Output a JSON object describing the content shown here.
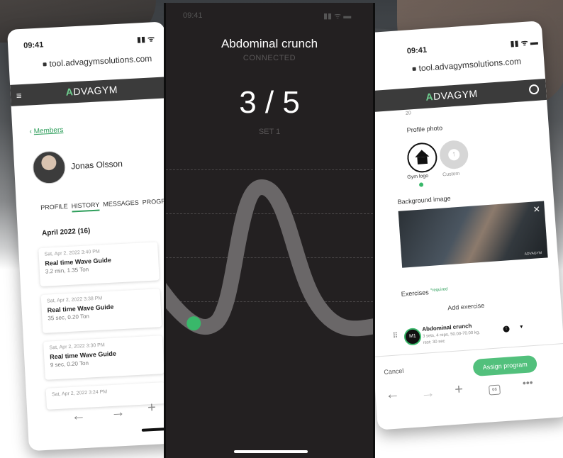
{
  "colors": {
    "accent": "#2e9e5b",
    "dot": "#39b86a",
    "dark": "#232021",
    "appbar": "#3b3b3b",
    "assign": "#52c07c",
    "wave": "#6a6768"
  },
  "left": {
    "time": "09:41",
    "url": "tool.advagymsolutions.com",
    "logo_prefix": "A",
    "logo_rest": "DVAGYM",
    "back_link": "Members",
    "user_name": "Jonas Olsson",
    "tabs": [
      "PROFILE",
      "HISTORY",
      "MESSAGES",
      "PROGRA"
    ],
    "month_header": "April 2022 (16)",
    "entries": [
      {
        "date": "Sat, Apr 2, 2022 3:40 PM",
        "title": "Real time Wave Guide",
        "meta": "3.2 min, 1.35 Ton"
      },
      {
        "date": "Sat, Apr 2, 2022 3:38 PM",
        "title": "Real time Wave Guide",
        "meta": "35 sec, 0.20 Ton"
      },
      {
        "date": "Sat, Apr 2, 2022 3:30 PM",
        "title": "Real time Wave Guide",
        "meta": "9 sec, 0.20 Ton"
      },
      {
        "date": "Sat, Apr 2, 2022 3:24 PM",
        "title": "",
        "meta": ""
      }
    ]
  },
  "center": {
    "time": "09:41",
    "title": "Abdominal crunch",
    "status": "CONNECTED",
    "counter": "3 / 5",
    "set_label": "SET 1",
    "progress": 0.12
  },
  "right": {
    "time": "09:41",
    "url": "tool.advagymsolutions.com",
    "logo_prefix": "A",
    "logo_rest": "DVAGYM",
    "partial_value": "20",
    "profile_photo_label": "Profile photo",
    "gym_logo_label": "Gym logo",
    "custom_label": "Custom",
    "background_image_label": "Background image",
    "image_watermark": "ADVAGYM",
    "exercises_label": "Exercises",
    "required_label": "*required",
    "add_exercise": "Add exercise",
    "exercise": {
      "badge": "M1",
      "name": "Abdominal crunch",
      "details": "3 sets, 4 reps, 50.00-70.00 kg,",
      "rest": "rest: 30 sec"
    },
    "cancel": "Cancel",
    "assign": "Assign program"
  }
}
